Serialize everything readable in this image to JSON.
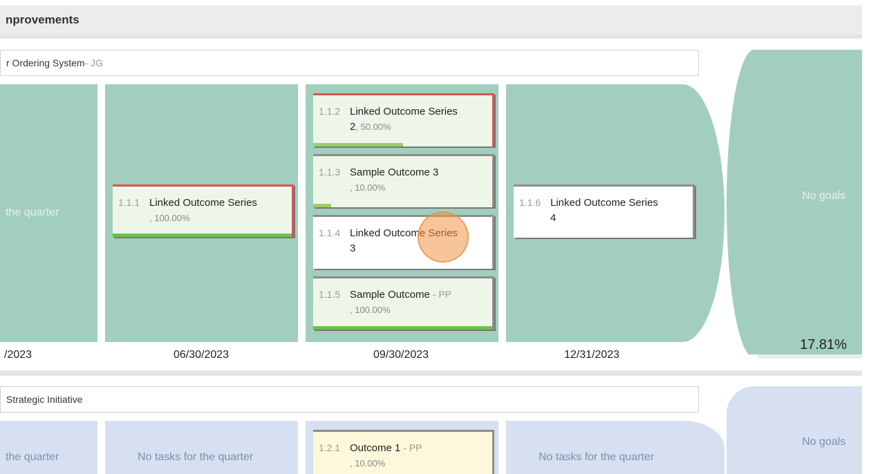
{
  "header": {
    "title": "nprovements"
  },
  "goal1": {
    "title": "r Ordering System",
    "owner": " - JG",
    "columns": [
      {
        "empty_text": "the quarter",
        "date": "/2023"
      },
      {
        "date": "06/30/2023"
      },
      {
        "date": "09/30/2023"
      },
      {
        "date": "12/31/2023"
      }
    ],
    "cards": [
      {
        "num": "1.1.1",
        "name": "Linked Outcome Series",
        "pct": ", 100.00%",
        "progress": 1.0
      },
      {
        "num": "1.1.2",
        "name": "Linked Outcome Series",
        "name2": "2",
        "pct": ", 50.00%",
        "progress": 0.5
      },
      {
        "num": "1.1.3",
        "name": "Sample Outcome 3",
        "pct": ", 10.00%",
        "progress": 0.1
      },
      {
        "num": "1.1.4",
        "name": "Linked Outcome Series",
        "name2": "3"
      },
      {
        "num": "1.1.5",
        "name": "Sample Outcome",
        "suffix": " - PP",
        "pct": ", 100.00%",
        "progress": 1.0
      },
      {
        "num": "1.1.6",
        "name": "Linked Outcome Series",
        "name2": "4"
      }
    ],
    "right_panel": {
      "no_goals": "No goals",
      "percent": "17.81%",
      "progress": 0.17
    }
  },
  "goal2": {
    "title": "Strategic Initiative",
    "columns": [
      {
        "empty_text": "the quarter"
      },
      {
        "empty_text": "No tasks for the quarter"
      },
      {},
      {
        "empty_text": "No tasks for the quarter"
      }
    ],
    "cards": [
      {
        "num": "1.2.1",
        "name": "Outcome 1",
        "suffix": " - PP",
        "pct": ", 10.00%"
      }
    ],
    "right_panel": {
      "no_goals": "No goals"
    }
  },
  "colors": {
    "green_col": "#a2cebe",
    "blue_col": "#d6e0f1",
    "progress_green": "#6ac14b",
    "edge_red": "#d9534f"
  }
}
